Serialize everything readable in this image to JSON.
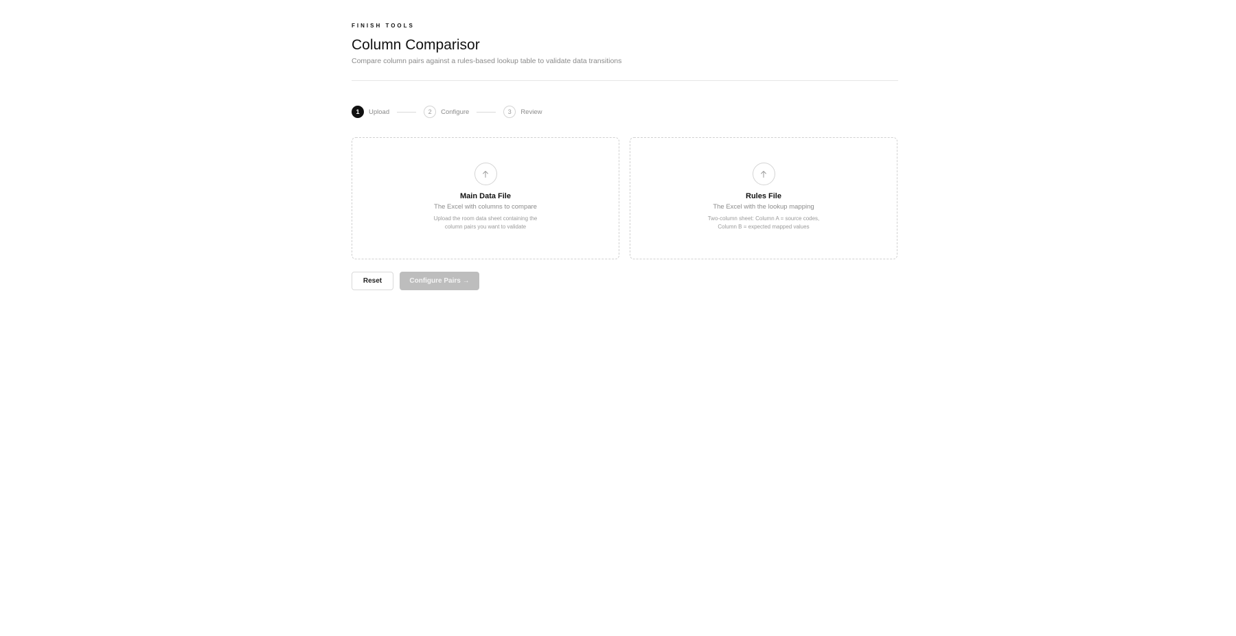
{
  "header": {
    "eyebrow": "FINISH TOOLS",
    "title": "Column Comparisor",
    "subtitle": "Compare column pairs against a rules-based lookup table to validate data transitions"
  },
  "stepper": {
    "steps": [
      {
        "number": "1",
        "label": "Upload",
        "active": true
      },
      {
        "number": "2",
        "label": "Configure",
        "active": false
      },
      {
        "number": "3",
        "label": "Review",
        "active": false
      }
    ]
  },
  "upload_cards": [
    {
      "icon": "upload-arrow-icon",
      "title": "Main Data File",
      "description": "The Excel with columns to compare",
      "help_lines": [
        "Upload the room data sheet containing the",
        "column pairs you want to validate"
      ]
    },
    {
      "icon": "upload-arrow-icon",
      "title": "Rules File",
      "description": "The Excel with the lookup mapping",
      "help_lines": [
        "Two-column sheet: Column A = source codes,",
        "Column B = expected mapped values"
      ]
    }
  ],
  "actions": {
    "reset_label": "Reset",
    "configure_label": "Configure Pairs →",
    "configure_disabled": true
  },
  "colors": {
    "accent": "#111111",
    "muted_text": "#8a8a8a",
    "border": "#d0d0d0",
    "disabled_button": "#bdbdbd"
  }
}
